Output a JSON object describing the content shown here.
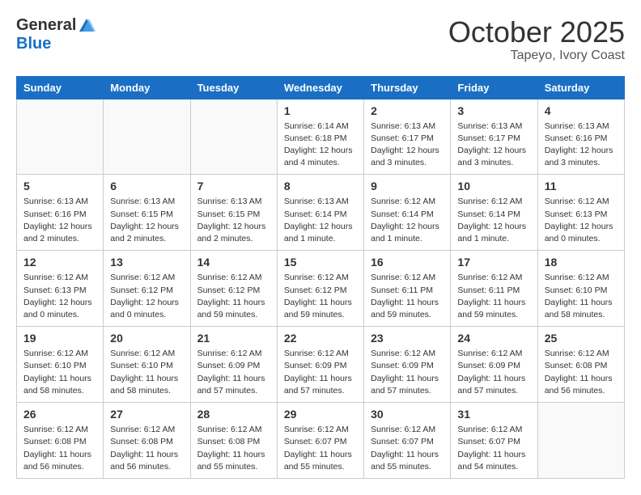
{
  "logo": {
    "general": "General",
    "blue": "Blue"
  },
  "title": "October 2025",
  "location": "Tapeyo, Ivory Coast",
  "headers": [
    "Sunday",
    "Monday",
    "Tuesday",
    "Wednesday",
    "Thursday",
    "Friday",
    "Saturday"
  ],
  "weeks": [
    [
      {
        "day": "",
        "info": ""
      },
      {
        "day": "",
        "info": ""
      },
      {
        "day": "",
        "info": ""
      },
      {
        "day": "1",
        "info": "Sunrise: 6:14 AM\nSunset: 6:18 PM\nDaylight: 12 hours\nand 4 minutes."
      },
      {
        "day": "2",
        "info": "Sunrise: 6:13 AM\nSunset: 6:17 PM\nDaylight: 12 hours\nand 3 minutes."
      },
      {
        "day": "3",
        "info": "Sunrise: 6:13 AM\nSunset: 6:17 PM\nDaylight: 12 hours\nand 3 minutes."
      },
      {
        "day": "4",
        "info": "Sunrise: 6:13 AM\nSunset: 6:16 PM\nDaylight: 12 hours\nand 3 minutes."
      }
    ],
    [
      {
        "day": "5",
        "info": "Sunrise: 6:13 AM\nSunset: 6:16 PM\nDaylight: 12 hours\nand 2 minutes."
      },
      {
        "day": "6",
        "info": "Sunrise: 6:13 AM\nSunset: 6:15 PM\nDaylight: 12 hours\nand 2 minutes."
      },
      {
        "day": "7",
        "info": "Sunrise: 6:13 AM\nSunset: 6:15 PM\nDaylight: 12 hours\nand 2 minutes."
      },
      {
        "day": "8",
        "info": "Sunrise: 6:13 AM\nSunset: 6:14 PM\nDaylight: 12 hours\nand 1 minute."
      },
      {
        "day": "9",
        "info": "Sunrise: 6:12 AM\nSunset: 6:14 PM\nDaylight: 12 hours\nand 1 minute."
      },
      {
        "day": "10",
        "info": "Sunrise: 6:12 AM\nSunset: 6:14 PM\nDaylight: 12 hours\nand 1 minute."
      },
      {
        "day": "11",
        "info": "Sunrise: 6:12 AM\nSunset: 6:13 PM\nDaylight: 12 hours\nand 0 minutes."
      }
    ],
    [
      {
        "day": "12",
        "info": "Sunrise: 6:12 AM\nSunset: 6:13 PM\nDaylight: 12 hours\nand 0 minutes."
      },
      {
        "day": "13",
        "info": "Sunrise: 6:12 AM\nSunset: 6:12 PM\nDaylight: 12 hours\nand 0 minutes."
      },
      {
        "day": "14",
        "info": "Sunrise: 6:12 AM\nSunset: 6:12 PM\nDaylight: 11 hours\nand 59 minutes."
      },
      {
        "day": "15",
        "info": "Sunrise: 6:12 AM\nSunset: 6:12 PM\nDaylight: 11 hours\nand 59 minutes."
      },
      {
        "day": "16",
        "info": "Sunrise: 6:12 AM\nSunset: 6:11 PM\nDaylight: 11 hours\nand 59 minutes."
      },
      {
        "day": "17",
        "info": "Sunrise: 6:12 AM\nSunset: 6:11 PM\nDaylight: 11 hours\nand 59 minutes."
      },
      {
        "day": "18",
        "info": "Sunrise: 6:12 AM\nSunset: 6:10 PM\nDaylight: 11 hours\nand 58 minutes."
      }
    ],
    [
      {
        "day": "19",
        "info": "Sunrise: 6:12 AM\nSunset: 6:10 PM\nDaylight: 11 hours\nand 58 minutes."
      },
      {
        "day": "20",
        "info": "Sunrise: 6:12 AM\nSunset: 6:10 PM\nDaylight: 11 hours\nand 58 minutes."
      },
      {
        "day": "21",
        "info": "Sunrise: 6:12 AM\nSunset: 6:09 PM\nDaylight: 11 hours\nand 57 minutes."
      },
      {
        "day": "22",
        "info": "Sunrise: 6:12 AM\nSunset: 6:09 PM\nDaylight: 11 hours\nand 57 minutes."
      },
      {
        "day": "23",
        "info": "Sunrise: 6:12 AM\nSunset: 6:09 PM\nDaylight: 11 hours\nand 57 minutes."
      },
      {
        "day": "24",
        "info": "Sunrise: 6:12 AM\nSunset: 6:09 PM\nDaylight: 11 hours\nand 57 minutes."
      },
      {
        "day": "25",
        "info": "Sunrise: 6:12 AM\nSunset: 6:08 PM\nDaylight: 11 hours\nand 56 minutes."
      }
    ],
    [
      {
        "day": "26",
        "info": "Sunrise: 6:12 AM\nSunset: 6:08 PM\nDaylight: 11 hours\nand 56 minutes."
      },
      {
        "day": "27",
        "info": "Sunrise: 6:12 AM\nSunset: 6:08 PM\nDaylight: 11 hours\nand 56 minutes."
      },
      {
        "day": "28",
        "info": "Sunrise: 6:12 AM\nSunset: 6:08 PM\nDaylight: 11 hours\nand 55 minutes."
      },
      {
        "day": "29",
        "info": "Sunrise: 6:12 AM\nSunset: 6:07 PM\nDaylight: 11 hours\nand 55 minutes."
      },
      {
        "day": "30",
        "info": "Sunrise: 6:12 AM\nSunset: 6:07 PM\nDaylight: 11 hours\nand 55 minutes."
      },
      {
        "day": "31",
        "info": "Sunrise: 6:12 AM\nSunset: 6:07 PM\nDaylight: 11 hours\nand 54 minutes."
      },
      {
        "day": "",
        "info": ""
      }
    ]
  ]
}
